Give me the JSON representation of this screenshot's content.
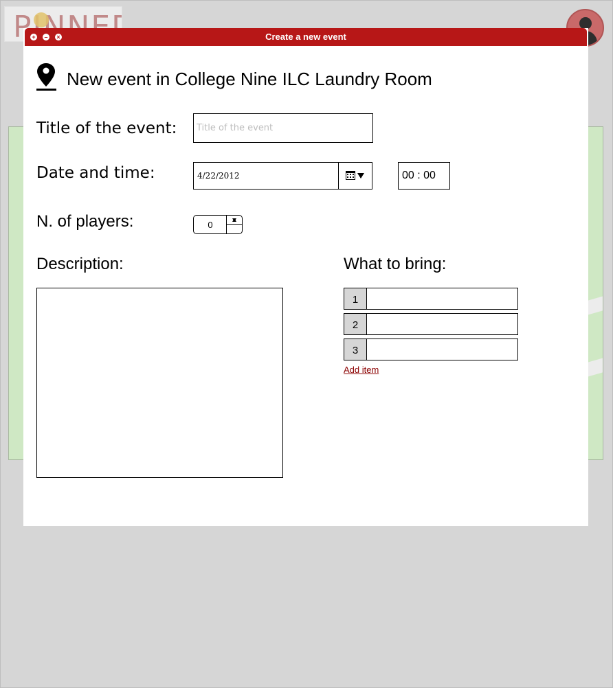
{
  "app": {
    "logo_text": "PINNED",
    "colors": {
      "accent": "#b71717",
      "map_green": "#cfe8c4",
      "background": "#d6d6d6"
    }
  },
  "dialog": {
    "title": "Create a new event",
    "window_buttons": [
      "maximize-icon",
      "minimize-icon",
      "close-icon"
    ],
    "heading": "New event in College Nine ILC Laundry Room",
    "title_label": "Title of the event:",
    "title_placeholder": "Title of the event",
    "title_value": "",
    "date_label": "Date and time:",
    "date_value": "4/22/2012",
    "time_value": "00 : 00",
    "players_label": "N. of players:",
    "players_value": "0",
    "description_label": "Description:",
    "description_value": "",
    "bring_label": "What to bring:",
    "bring_items": [
      {
        "number": "1",
        "value": ""
      },
      {
        "number": "2",
        "value": ""
      },
      {
        "number": "3",
        "value": ""
      }
    ],
    "add_item_label": "Add item"
  }
}
